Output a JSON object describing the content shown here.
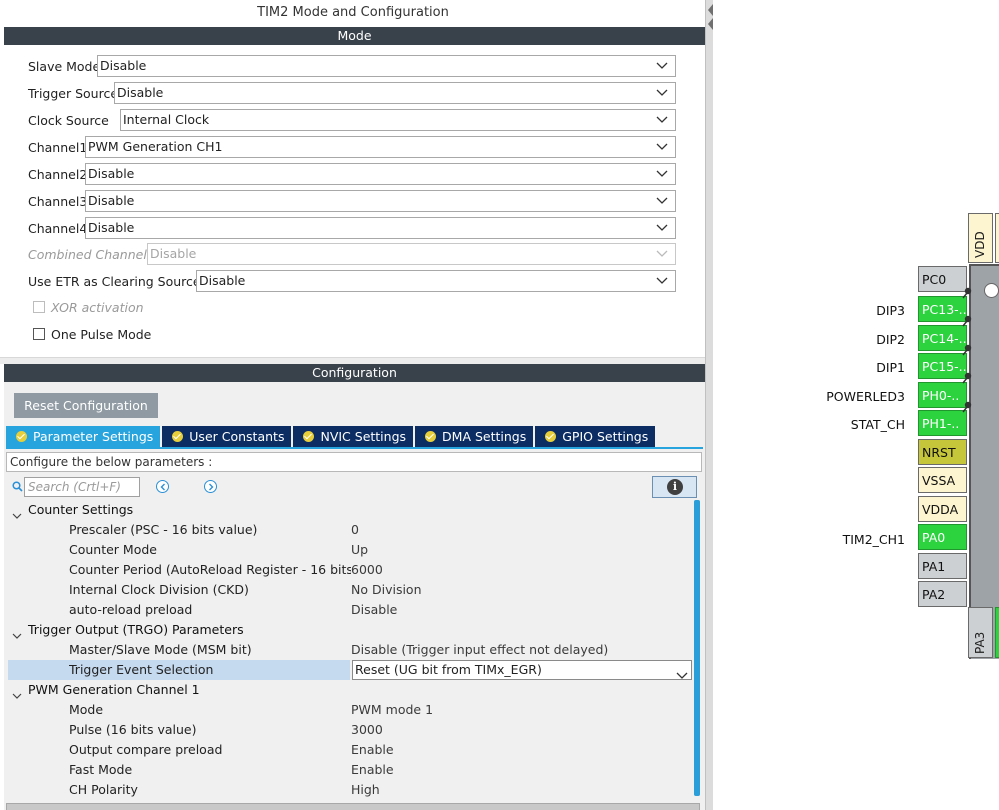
{
  "panel_title": "TIM2 Mode and Configuration",
  "mode": {
    "section_label": "Mode",
    "rows": [
      {
        "label": "Slave Mode",
        "value": "Disable"
      },
      {
        "label": "Trigger Source",
        "value": "Disable"
      },
      {
        "label": "Clock Source",
        "value": "Internal Clock"
      },
      {
        "label": "Channel1",
        "value": "PWM Generation CH1"
      },
      {
        "label": "Channel2",
        "value": "Disable"
      },
      {
        "label": "Channel3",
        "value": "Disable"
      },
      {
        "label": "Channel4",
        "value": "Disable"
      },
      {
        "label": "Combined Channels",
        "value": "Disable"
      },
      {
        "label": "Use ETR as Clearing Source",
        "value": "Disable"
      }
    ],
    "xor_activation": "XOR activation",
    "one_pulse_mode": "One Pulse Mode"
  },
  "configuration": {
    "section_label": "Configuration",
    "reset_button": "Reset Configuration",
    "tabs": [
      "Parameter Settings",
      "User Constants",
      "NVIC Settings",
      "DMA Settings",
      "GPIO Settings"
    ],
    "note": "Configure the below parameters :",
    "search_placeholder": "Search (Crtl+F)",
    "tree": {
      "counter_settings": "Counter Settings",
      "prescaler": {
        "name": "Prescaler (PSC - 16 bits value)",
        "value": "0"
      },
      "counter_mode": {
        "name": "Counter Mode",
        "value": "Up"
      },
      "counter_period": {
        "name": "Counter Period (AutoReload Register - 16 bits ...",
        "value": "6000"
      },
      "clock_division": {
        "name": "Internal Clock Division (CKD)",
        "value": "No Division"
      },
      "auto_reload": {
        "name": "auto-reload preload",
        "value": "Disable"
      },
      "trgo": "Trigger Output (TRGO) Parameters",
      "master_slave": {
        "name": "Master/Slave Mode (MSM bit)",
        "value": "Disable (Trigger input effect not delayed)"
      },
      "trigger_event": {
        "name": "Trigger Event Selection",
        "value": "Reset (UG bit from TIMx_EGR)"
      },
      "pwm_ch1": "PWM Generation Channel 1",
      "mode": {
        "name": "Mode",
        "value": "PWM mode 1"
      },
      "pulse": {
        "name": "Pulse (16 bits value)",
        "value": "3000"
      },
      "oc_preload": {
        "name": "Output compare preload",
        "value": "Enable"
      },
      "fast_mode": {
        "name": "Fast Mode",
        "value": "Enable"
      },
      "ch_polarity": {
        "name": "CH Polarity",
        "value": "High"
      }
    }
  },
  "pinout": {
    "vdd": "VDD",
    "pa3": "PA3",
    "pins": [
      {
        "name": "PC0",
        "label": ""
      },
      {
        "name": "PC13-..",
        "label": "DIP3"
      },
      {
        "name": "PC14-..",
        "label": "DIP2"
      },
      {
        "name": "PC15-..",
        "label": "DIP1"
      },
      {
        "name": "PH0-..",
        "label": "POWERLED3"
      },
      {
        "name": "PH1-..",
        "label": "STAT_CH"
      },
      {
        "name": "NRST",
        "label": ""
      },
      {
        "name": "VSSA",
        "label": ""
      },
      {
        "name": "VDDA",
        "label": ""
      },
      {
        "name": "PA0",
        "label": "TIM2_CH1"
      },
      {
        "name": "PA1",
        "label": ""
      },
      {
        "name": "PA2",
        "label": ""
      }
    ]
  },
  "colors": {
    "section_bar": "#39414a",
    "tab_active": "#27a3dd",
    "tab_inactive": "#0b2d63",
    "pin_green": "#2cd33f",
    "pin_olive": "#c6c63a",
    "pin_power": "#fdf5cf",
    "selected_row": "#c5d9ef"
  },
  "icons": {
    "dropdown": "chevron-down-icon",
    "search": "search-icon",
    "info": "info-icon",
    "nav_prev": "nav-left-icon",
    "nav_next": "nav-right-icon",
    "tab_check": "check-circle-icon",
    "splitter": "collapse-arrow-icon"
  }
}
